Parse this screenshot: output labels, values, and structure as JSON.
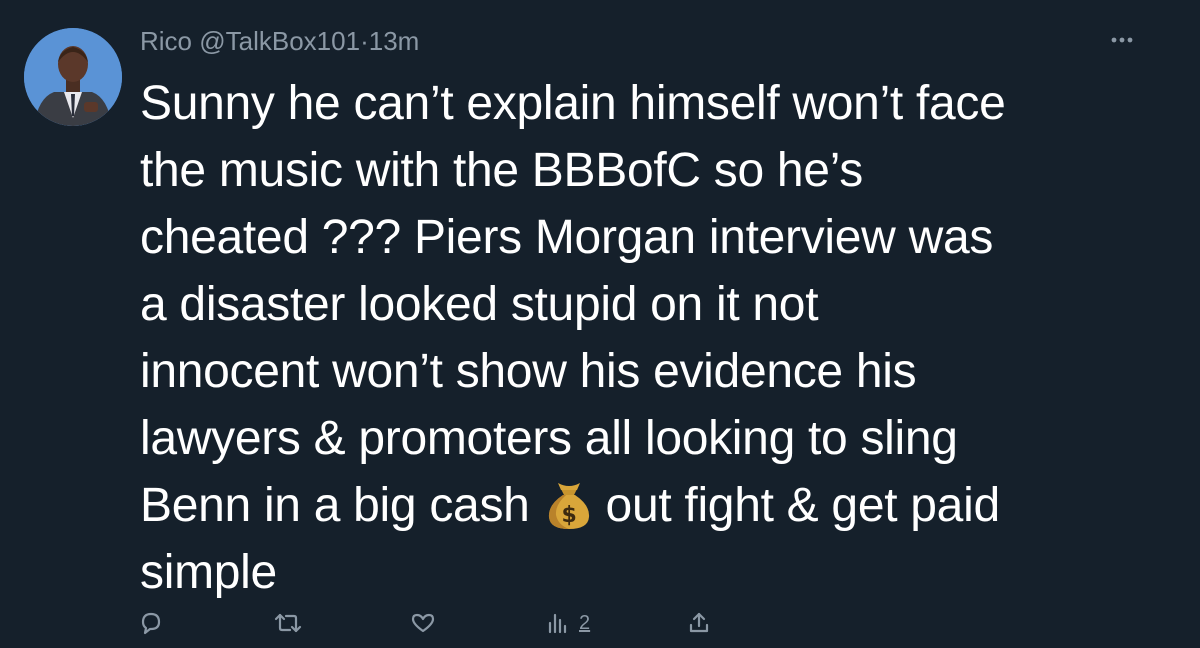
{
  "tweet": {
    "author_name": "Rico",
    "handle": "@TalkBox101",
    "separator": "·",
    "time": "13m",
    "text_lines": [
      "Sunny he can’t explain himself won’t face",
      "the music with the BBBofC so he’s",
      "cheated ??? Piers Morgan interview was",
      "a disaster looked stupid on it not",
      "innocent won’t show his evidence his",
      "lawyers & promoters all looking to sling",
      "Benn in a big cash",
      "out fight & get paid",
      "simple"
    ],
    "emoji": "money-bag-icon",
    "views_count": "2"
  },
  "colors": {
    "background": "#15202b",
    "text": "#ffffff",
    "secondary": "#8b98a5"
  }
}
